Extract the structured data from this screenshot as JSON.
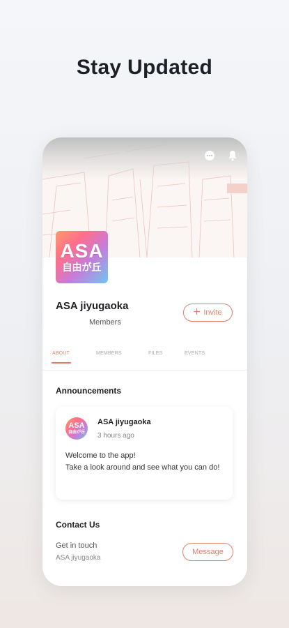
{
  "headline": "Stay Updated",
  "group": {
    "avatar_line1": "ASA",
    "avatar_line2": "自由が丘",
    "name": "ASA jiyugaoka",
    "members_label": "Members",
    "invite_label": "Invite"
  },
  "tabs": [
    "ABOUT",
    "MEMBERS",
    "FILES",
    "EVENTS"
  ],
  "announcements": {
    "title": "Announcements",
    "author": "ASA jiyugaoka",
    "time": "3 hours ago",
    "lines": [
      "Welcome to the app!",
      "Take a look around and see what you can do!"
    ]
  },
  "contact": {
    "title": "Contact Us",
    "get_in_touch": "Get in touch",
    "name": "ASA jiyugaoka",
    "message_label": "Message"
  },
  "colors": {
    "accent": "#e57e6c"
  },
  "icons": [
    "chat-icon",
    "bell-icon",
    "plus-icon"
  ]
}
